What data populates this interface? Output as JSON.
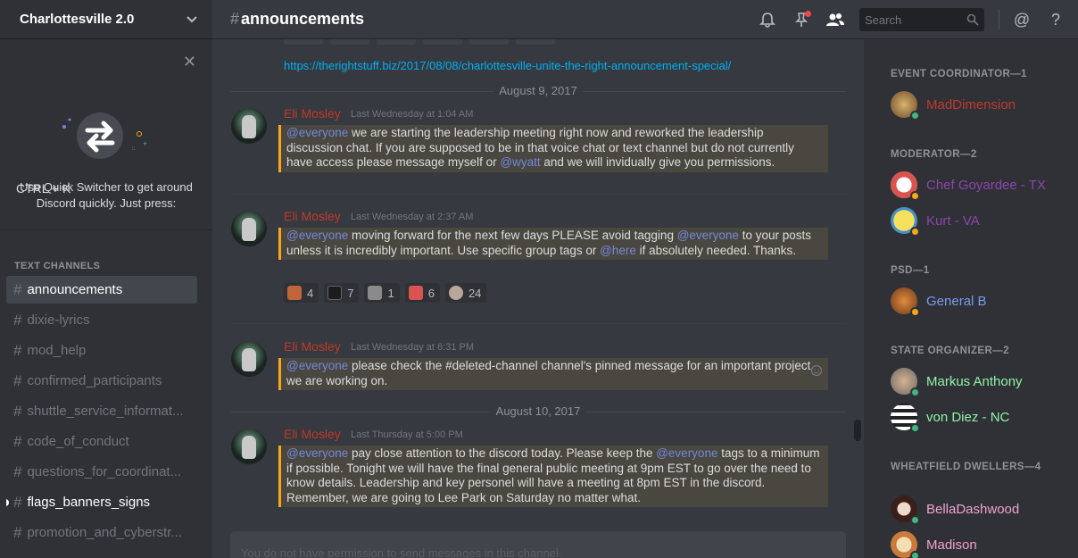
{
  "sidebar": {
    "server_name": "Charlottesville 2.0",
    "quick_switcher": {
      "tip": "Use Quick Switcher to get around Discord quickly. Just press:",
      "shortcut": "CTRL + K"
    },
    "category": "TEXT CHANNELS",
    "channels": [
      {
        "name": "announcements",
        "state": "selected"
      },
      {
        "name": "dixie-lyrics",
        "state": "muted"
      },
      {
        "name": "mod_help",
        "state": "muted"
      },
      {
        "name": "confirmed_participants",
        "state": "muted"
      },
      {
        "name": "shuttle_service_informat...",
        "state": "muted"
      },
      {
        "name": "code_of_conduct",
        "state": "muted"
      },
      {
        "name": "questions_for_coordinat...",
        "state": "muted"
      },
      {
        "name": "flags_banners_signs",
        "state": "unread"
      },
      {
        "name": "promotion_and_cyberstr...",
        "state": "muted"
      }
    ]
  },
  "header": {
    "hash": "#",
    "channel": "announcements",
    "search_placeholder": "Search"
  },
  "chat": {
    "link": "https://therightstuff.biz/2017/08/08/charlottesville-unite-the-right-announcement-special/",
    "dividers": [
      "August 9, 2017",
      "August 10, 2017"
    ],
    "messages": [
      {
        "author": "Eli Mosley",
        "timestamp": "Last Wednesday at 1:04 AM",
        "m1": "@everyone",
        "t1": " we are starting the leadership meeting right now and reworked the leadership discussion chat. If you are supposed to be in that voice chat or text channel but do not currently have access please message myself or ",
        "m2": "@wyatt",
        "t2": " and we will invidually give you permissions."
      },
      {
        "author": "Eli Mosley",
        "timestamp": "Last Wednesday at 2:37 AM",
        "m1": "@everyone",
        "t1": " moving forward for the next few days PLEASE avoid tagging ",
        "m2": "@everyone",
        "t2": " to your posts unless it is incredibly important. Use specific group tags or ",
        "m3": "@here",
        "t3": " if absolutely needed. Thanks.",
        "reactions": [
          "4",
          "7",
          "1",
          "6",
          "24"
        ]
      },
      {
        "author": "Eli Mosley",
        "timestamp": "Last Wednesday at 6:31 PM",
        "m1": "@everyone",
        "t1": " please check the #deleted-channel channel's pinned message for an important project we are working on."
      },
      {
        "author": "Eli Mosley",
        "timestamp": "Last Thursday at 5:00 PM",
        "m1": "@everyone",
        "t1": " pay close attention to the discord today. Please keep the ",
        "m2": "@everyone",
        "t2": " tags to a minimum if possible. Tonight we will have the final general public meeting at 9pm EST to go over the need to know details. Leadership and key personel will have a meeting at 8pm EST in the discord. Remember, we are going to Lee Park on Saturday no matter what."
      }
    ],
    "input_placeholder": "You do not have permission to send messages in this channel."
  },
  "members": {
    "roles": [
      {
        "label": "EVENT COORDINATOR—1"
      },
      {
        "label": "MODERATOR—2"
      },
      {
        "label": "PSD—1"
      },
      {
        "label": "STATE ORGANIZER—2"
      },
      {
        "label": "WHEATFIELD DWELLERS—4"
      }
    ],
    "list": [
      {
        "name": "MadDimension",
        "color": "#c0392b"
      },
      {
        "name": "Chef Goyardee - TX",
        "color": "#8e44ad"
      },
      {
        "name": "Kurt - VA",
        "color": "#8e44ad"
      },
      {
        "name": "General B",
        "color": "#7a9bef"
      },
      {
        "name": "Markus Anthony",
        "color": "#8ef4a6"
      },
      {
        "name": "von Diez - NC",
        "color": "#8ef4a6"
      },
      {
        "name": "BellaDashwood",
        "color": "#f3a0d0"
      },
      {
        "name": "Madison",
        "color": "#f3a0d0"
      }
    ]
  },
  "colors": {
    "accent_mention": "#7289da",
    "highlight_border": "#faa61a",
    "author": "#c0392b",
    "link": "#00b0f4"
  }
}
